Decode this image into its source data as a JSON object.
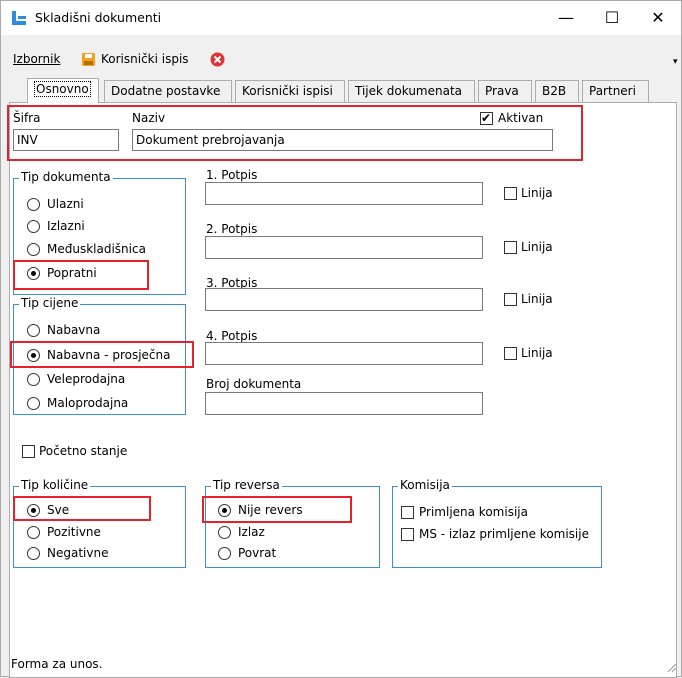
{
  "window": {
    "title": "Skladišni dokumenti",
    "minimize": "—",
    "maximize": "☐",
    "close": "✕"
  },
  "menu": {
    "izbornik": "Izbornik",
    "korisnicki_ispis": "Korisnički ispis"
  },
  "tabs": [
    "Osnovno",
    "Dodatne postavke",
    "Korisnički ispisi",
    "Tijek dokumenata",
    "Prava",
    "B2B",
    "Partneri"
  ],
  "fields": {
    "sifra_label": "Šifra",
    "sifra_value": "INV",
    "naziv_label": "Naziv",
    "naziv_value": "Dokument prebrojavanja",
    "aktivan_label": "Aktivan",
    "aktivan_checked": true
  },
  "tip_dokumenta": {
    "title": "Tip dokumenta",
    "options": [
      "Ulazni",
      "Izlazni",
      "Međuskladišnica",
      "Popratni"
    ],
    "selected": "Popratni"
  },
  "tip_cijene": {
    "title": "Tip cijene",
    "options": [
      "Nabavna",
      "Nabavna - prosječna",
      "Veleprodajna",
      "Maloprodajna"
    ],
    "selected": "Nabavna - prosječna"
  },
  "potpisi": [
    {
      "label": "1. Potpis",
      "linija": "Linija"
    },
    {
      "label": "2. Potpis",
      "linija": "Linija"
    },
    {
      "label": "3. Potpis",
      "linija": "Linija"
    },
    {
      "label": "4. Potpis",
      "linija": "Linija"
    }
  ],
  "broj_dokumenta_label": "Broj dokumenta",
  "pocetno_stanje_label": "Početno stanje",
  "tip_kolicine": {
    "title": "Tip količine",
    "options": [
      "Sve",
      "Pozitivne",
      "Negativne"
    ],
    "selected": "Sve"
  },
  "tip_reversa": {
    "title": "Tip reversa",
    "options": [
      "Nije revers",
      "Izlaz",
      "Povrat"
    ],
    "selected": "Nije revers"
  },
  "komisija": {
    "title": "Komisija",
    "options": [
      "Primljena komisija",
      "MS - izlaz primljene komisije"
    ]
  },
  "status": "Forma za unos.",
  "colors": {
    "group_border": "#3a8fd9",
    "highlight": "#e8202a",
    "app_icon": "#2e8be0"
  }
}
